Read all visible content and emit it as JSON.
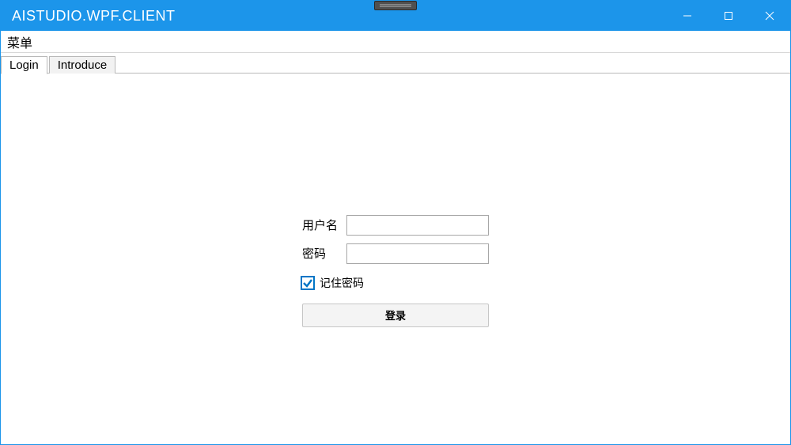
{
  "window": {
    "title": "AISTUDIO.WPF.CLIENT"
  },
  "menubar": {
    "items": [
      {
        "label": "菜单"
      }
    ]
  },
  "tabs": [
    {
      "label": "Login",
      "active": true
    },
    {
      "label": "Introduce",
      "active": false
    }
  ],
  "login": {
    "username_label": "用户名",
    "password_label": "密码",
    "username_value": "",
    "password_value": "",
    "remember_label": "记住密码",
    "remember_checked": true,
    "submit_label": "登录"
  }
}
